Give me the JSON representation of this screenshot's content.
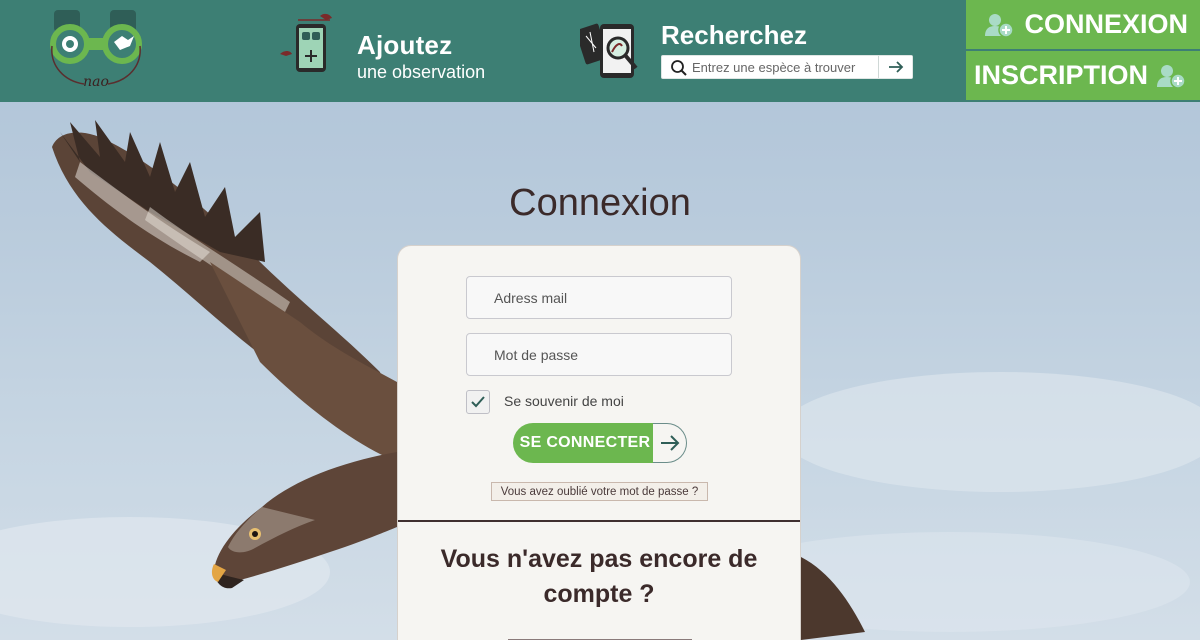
{
  "header": {
    "logo_alt": "nao",
    "nav_add": {
      "title": "Ajoutez",
      "subtitle": "une observation"
    },
    "nav_search": {
      "title": "Recherchez",
      "placeholder": "Entrez une espèce à trouver"
    },
    "auth": {
      "login_label": "CONNEXION",
      "signup_label": "INSCRIPTION"
    }
  },
  "login": {
    "title": "Connexion",
    "email_placeholder": "Adress mail",
    "password_placeholder": "Mot de passe",
    "remember_label": "Se souvenir de moi",
    "remember_checked": true,
    "submit_label": "SE CONNECTER",
    "forgot_label": "Vous avez oublié votre mot de passe ?",
    "no_account_title": "Vous n'avez pas encore de compte ?"
  },
  "colors": {
    "header_bg": "#3d7f74",
    "accent_green": "#6cb74f",
    "text_dark": "#3b2a2a"
  },
  "icons": [
    "binoculars-logo-icon",
    "phone-add-icon",
    "phone-search-icon",
    "search-icon",
    "arrow-right-icon",
    "user-add-icon",
    "checkmark-icon"
  ]
}
